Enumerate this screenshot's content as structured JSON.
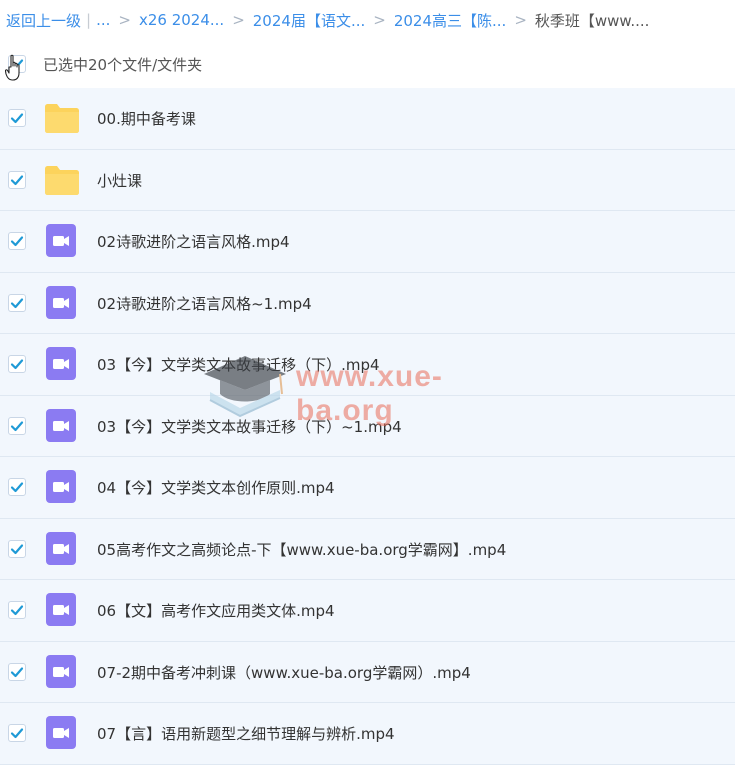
{
  "breadcrumb": {
    "back": "返回上一级",
    "ellipsis": "...",
    "crumbs": [
      "x26 2024...",
      "2024届【语文...",
      "2024高三【陈..."
    ],
    "current": "秋季班【www...."
  },
  "selection": {
    "label": "已选中20个文件/文件夹"
  },
  "files": [
    {
      "name": "00.期中备考课",
      "type": "folder",
      "checked": true
    },
    {
      "name": "小灶课",
      "type": "folder",
      "checked": true
    },
    {
      "name": "02诗歌进阶之语言风格.mp4",
      "type": "video",
      "checked": true
    },
    {
      "name": "02诗歌进阶之语言风格~1.mp4",
      "type": "video",
      "checked": true
    },
    {
      "name": "03【今】文学类文本故事迁移（下）.mp4",
      "type": "video",
      "checked": true
    },
    {
      "name": "03【今】文学类文本故事迁移（下）~1.mp4",
      "type": "video",
      "checked": true
    },
    {
      "name": "04【今】文学类文本创作原则.mp4",
      "type": "video",
      "checked": true
    },
    {
      "name": "05高考作文之高频论点-下【www.xue-ba.org学霸网】.mp4",
      "type": "video",
      "checked": true
    },
    {
      "name": "06【文】高考作文应用类文体.mp4",
      "type": "video",
      "checked": true
    },
    {
      "name": "07-2期中备考冲刺课（www.xue-ba.org学霸网）.mp4",
      "type": "video",
      "checked": true
    },
    {
      "name": "07【言】语用新题型之细节理解与辨析.mp4",
      "type": "video",
      "checked": true
    }
  ],
  "watermark": {
    "text": "www.xue-ba.org"
  },
  "colors": {
    "link": "#3b8ee8",
    "check": "#1f9ad6",
    "folder": "#fcd35c",
    "video": "#8b7bf2",
    "row_bg": "#f2f7fd"
  }
}
